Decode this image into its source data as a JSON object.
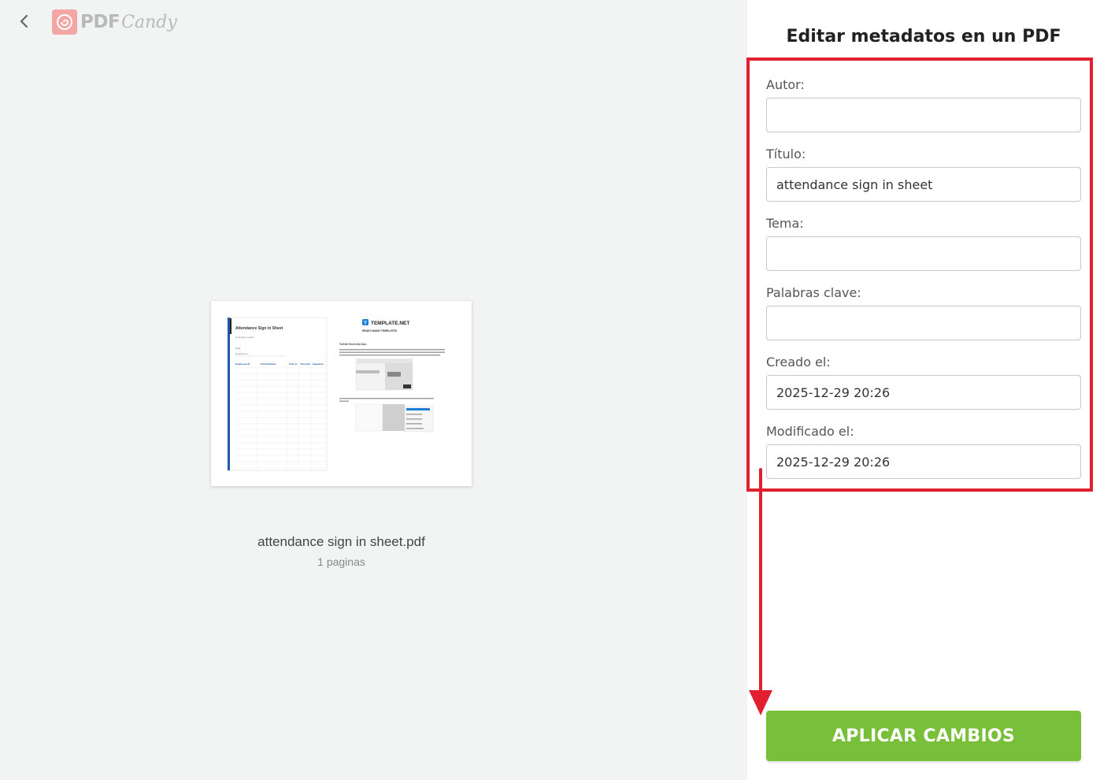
{
  "header": {
    "back_icon": "chevron-left-icon",
    "logo_pdf": "PDF",
    "logo_candy": "Candy"
  },
  "file": {
    "name": "attendance sign in sheet.pdf",
    "pages": "1 paginas",
    "thumbnail": {
      "left_title": "Attendance Sign in Sheet",
      "left_subtitle": "[Company name]",
      "left_date": "Date:",
      "left_department": "Department:",
      "columns": [
        "Employee ID",
        "Printed Name",
        "Time In",
        "Time Out",
        "Signature"
      ],
      "brand": "TEMPLATE.NET",
      "brand_sub": "READY-MADE TEMPLATES",
      "right_heading": "To Edit Text in the Doc:"
    }
  },
  "panel": {
    "title": "Editar metadatos en un PDF",
    "fields": [
      {
        "label": "Autor:",
        "value": ""
      },
      {
        "label": "Título:",
        "value": "attendance sign in sheet"
      },
      {
        "label": "Tema:",
        "value": ""
      },
      {
        "label": "Palabras clave:",
        "value": ""
      },
      {
        "label": "Creado el:",
        "value": "2025-12-29 20:26"
      },
      {
        "label": "Modificado el:",
        "value": "2025-12-29 20:26"
      }
    ],
    "apply_label": "APLICAR CAMBIOS"
  },
  "colors": {
    "accent_green": "#78c03a",
    "highlight_red": "#e0202e",
    "logo_pink": "#f3a6a3"
  }
}
